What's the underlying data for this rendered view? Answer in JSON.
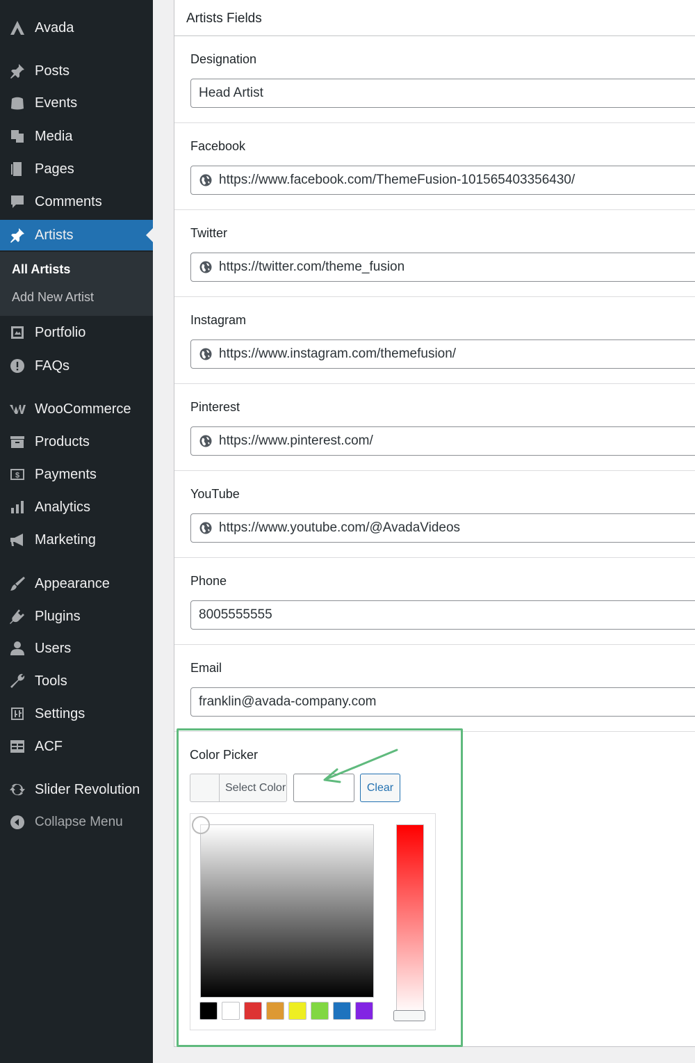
{
  "sidebar": {
    "brand": {
      "label": "Avada",
      "icon": "avada-icon"
    },
    "items": [
      {
        "label": "Posts",
        "icon": "pushpin-icon"
      },
      {
        "label": "Events",
        "icon": "events-icon"
      },
      {
        "label": "Media",
        "icon": "media-icon"
      },
      {
        "label": "Pages",
        "icon": "pages-icon"
      },
      {
        "label": "Comments",
        "icon": "comment-icon"
      },
      {
        "label": "Artists",
        "icon": "pushpin-icon",
        "active": true
      },
      {
        "label": "Portfolio",
        "icon": "portfolio-icon"
      },
      {
        "label": "FAQs",
        "icon": "info-icon"
      },
      {
        "label": "WooCommerce",
        "icon": "woocommerce-icon"
      },
      {
        "label": "Products",
        "icon": "archive-icon"
      },
      {
        "label": "Payments",
        "icon": "payments-icon"
      },
      {
        "label": "Analytics",
        "icon": "bar-chart-icon"
      },
      {
        "label": "Marketing",
        "icon": "megaphone-icon"
      },
      {
        "label": "Appearance",
        "icon": "paintbrush-icon"
      },
      {
        "label": "Plugins",
        "icon": "plugin-icon"
      },
      {
        "label": "Users",
        "icon": "user-icon"
      },
      {
        "label": "Tools",
        "icon": "wrench-icon"
      },
      {
        "label": "Settings",
        "icon": "settings-icon"
      },
      {
        "label": "ACF",
        "icon": "table-icon"
      },
      {
        "label": "Slider Revolution",
        "icon": "refresh-icon"
      }
    ],
    "submenu": [
      {
        "label": "All Artists",
        "current": true
      },
      {
        "label": "Add New Artist"
      }
    ],
    "collapse": {
      "label": "Collapse Menu",
      "icon": "collapse-icon"
    }
  },
  "panel": {
    "title": "Artists Fields",
    "fields": [
      {
        "label": "Designation",
        "value": "Head Artist",
        "type": "text"
      },
      {
        "label": "Facebook",
        "value": "https://www.facebook.com/ThemeFusion-101565403356430/",
        "type": "url"
      },
      {
        "label": "Twitter",
        "value": "https://twitter.com/theme_fusion",
        "type": "url"
      },
      {
        "label": "Instagram",
        "value": "https://www.instagram.com/themefusion/",
        "type": "url"
      },
      {
        "label": "Pinterest",
        "value": "https://www.pinterest.com/",
        "type": "url"
      },
      {
        "label": "YouTube",
        "value": "https://www.youtube.com/@AvadaVideos",
        "type": "url"
      },
      {
        "label": "Phone",
        "value": "8005555555",
        "type": "text"
      },
      {
        "label": "Email",
        "value": "franklin@avada-company.com",
        "type": "text"
      }
    ],
    "color_picker": {
      "label": "Color Picker",
      "select_label": "Select Color",
      "clear_label": "Clear",
      "highlight_color": "#5fba7d",
      "hue_color": "#ff0000",
      "palette": [
        "#000000",
        "#ffffff",
        "#dd3333",
        "#dd9933",
        "#eeee22",
        "#81d742",
        "#1e73be",
        "#8224e3"
      ]
    }
  },
  "colors": {
    "sidebar_bg": "#1d2327",
    "submenu_bg": "#2c3338",
    "accent": "#2271b1",
    "content_bg": "#f0f0f1"
  }
}
